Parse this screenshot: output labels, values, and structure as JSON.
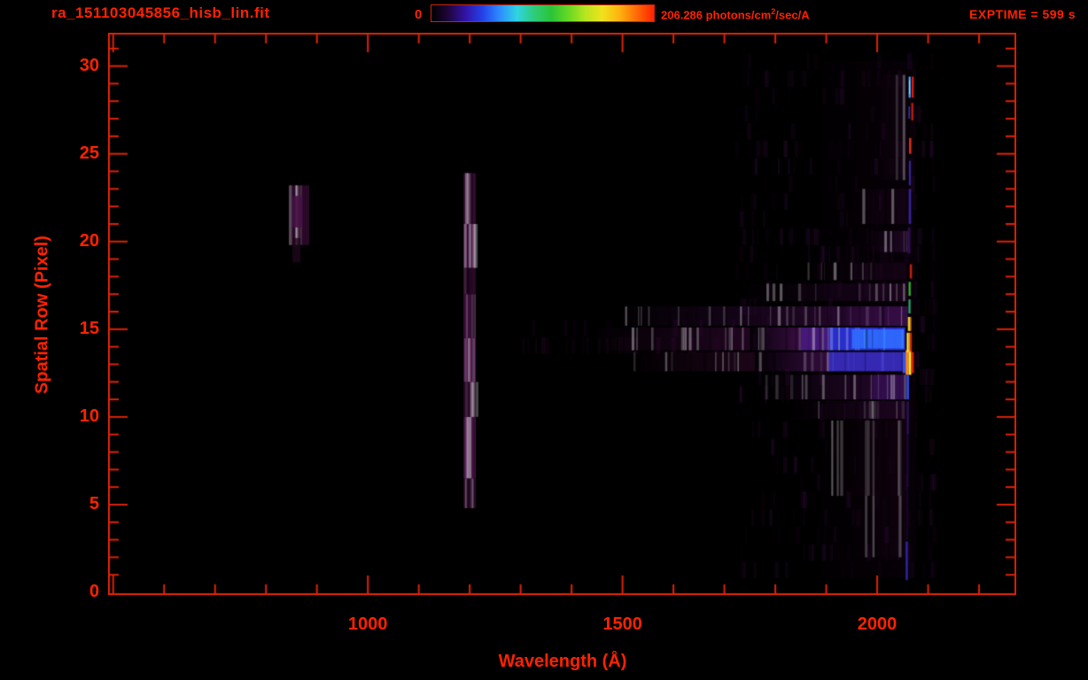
{
  "colors": {
    "accent": "#ff2200",
    "frame": "#dd2206",
    "background": "#000000"
  },
  "header": {
    "filename": "ra_151103045856_hisb_lin.fit",
    "exptime_label": "EXPTIME = 599 s",
    "colorbar": {
      "min_label": "0",
      "max_label_prefix": "206.286 photons/cm",
      "max_label_sup": "2",
      "max_label_suffix": "/sec/A",
      "gradient": [
        "#000000",
        "#20063c",
        "#3313a8",
        "#2542e8",
        "#2e8cff",
        "#2fd4e2",
        "#2ecc7a",
        "#2bc437",
        "#66d824",
        "#b8e51e",
        "#f0e21c",
        "#ffb10e",
        "#ff6a06",
        "#ff2200"
      ]
    }
  },
  "chart_data": {
    "type": "heatmap",
    "title": "ra_151103045856_hisb_lin.fit",
    "xlabel": "Wavelength (Å)",
    "ylabel": "Spatial Row (Pixel)",
    "x_range": [
      490,
      2273
    ],
    "y_range": [
      -0.15,
      31.9
    ],
    "x_major_ticks": [
      1000,
      1500,
      2000
    ],
    "x_major_unlabeled": [
      500
    ],
    "x_minor_step": 100,
    "y_major_ticks": [
      0,
      5,
      10,
      15,
      20,
      25,
      30
    ],
    "y_minor_step": 1,
    "colorbar": {
      "min": 0,
      "max": 206.286,
      "units": "photons/cm2/sec/A"
    },
    "exptime_seconds": 599,
    "grid": false,
    "legend": "none",
    "description": "Far-UV slit spectrogram: faint Lyman-alpha airglow band near 1200 A over rows 5-24, a faint emission blob near 870 A rows 20-23, a bright stellar continuum in rows 12-16 strengthening from ~1500 A to ~2060 A (peaking blue/cyan at rows 13.8-15), and a saturated multicolor emission spike at ~2063 A spanning rows 1-29.",
    "features": {
      "wash": [
        [
          1850,
          2075,
          0.8,
          30.3,
          "#0d020d",
          0.55,
          1,
          0
        ]
      ],
      "rects": [
        [
          1188,
          1212,
          4.8,
          6.5,
          "#2a0928",
          0.95,
          0,
          1
        ],
        [
          1188,
          1212,
          6.5,
          10.0,
          "#451243",
          0.95,
          0,
          1
        ],
        [
          1188,
          1212,
          10.0,
          12.0,
          "#2e0a2c",
          0.95,
          0,
          1
        ],
        [
          1188,
          1212,
          12.0,
          14.5,
          "#491347",
          0.95,
          0,
          1
        ],
        [
          1188,
          1212,
          14.5,
          17.0,
          "#3d0f3b",
          0.95,
          0,
          1
        ],
        [
          1188,
          1212,
          17.0,
          18.5,
          "#2a0928",
          0.95,
          0,
          1
        ],
        [
          1188,
          1212,
          18.5,
          21.0,
          "#451243",
          0.95,
          0,
          1
        ],
        [
          1188,
          1212,
          21.0,
          23.9,
          "#350c33",
          0.95,
          0,
          1
        ],
        [
          845,
          885,
          19.8,
          23.2,
          "#2d092b",
          0.9,
          0,
          1
        ],
        [
          852,
          872,
          20.8,
          22.6,
          "#451144",
          0.9,
          0,
          0
        ],
        [
          852,
          868,
          18.8,
          20.2,
          "#1e061c",
          0.8,
          0,
          0
        ],
        [
          1500,
          2060,
          15.2,
          16.3,
          "#2e0a36",
          0.9,
          1,
          1
        ],
        [
          1900,
          2060,
          15.2,
          16.3,
          "#3a1050",
          0.7,
          1,
          1
        ],
        [
          1450,
          1750,
          13.8,
          15.1,
          "#260726",
          0.85,
          1,
          1
        ],
        [
          1750,
          1850,
          13.8,
          15.1,
          "#3c0e46",
          0.95,
          1,
          1
        ],
        [
          1850,
          1905,
          13.8,
          15.1,
          "#4a1a80",
          0.95,
          0,
          1
        ],
        [
          1905,
          2055,
          13.8,
          15.1,
          "#2a30d8",
          0.95,
          0,
          1
        ],
        [
          1950,
          2052,
          13.9,
          15.0,
          "#2f6bff",
          0.9,
          0,
          1,
          "#54e2ff"
        ],
        [
          1520,
          1760,
          12.6,
          13.7,
          "#23071f",
          0.8,
          1,
          1
        ],
        [
          1760,
          1905,
          12.6,
          13.7,
          "#3a0d46",
          0.9,
          1,
          1
        ],
        [
          1905,
          2050,
          12.6,
          13.7,
          "#3b2cc4",
          0.9,
          0,
          1,
          "#5a6aff"
        ],
        [
          2050,
          2056,
          12.5,
          13.7,
          "#3a55ff",
          0.95,
          0,
          0
        ],
        [
          2056,
          2062,
          12.4,
          13.8,
          "#ff8c1c",
          1,
          0,
          0
        ],
        [
          2062,
          2067,
          12.4,
          13.8,
          "#ffe93a",
          1,
          0,
          0
        ],
        [
          2067,
          2072,
          12.5,
          13.7,
          "#e02211",
          0.95,
          0,
          0
        ],
        [
          1780,
          2055,
          11.0,
          12.4,
          "#2c0a34",
          0.85,
          1,
          1
        ],
        [
          1990,
          2055,
          11.0,
          12.4,
          "#3a1260",
          0.6,
          0,
          1
        ],
        [
          1840,
          2056,
          9.9,
          10.9,
          "#220726",
          0.8,
          1,
          1
        ],
        [
          1740,
          2058,
          16.6,
          17.6,
          "#200624",
          0.75,
          1,
          1
        ],
        [
          1860,
          2058,
          17.8,
          18.8,
          "#1a051a",
          0.65,
          1,
          1
        ],
        [
          1985,
          2058,
          19.4,
          20.6,
          "#2c0a33",
          0.7,
          1,
          1
        ],
        [
          1950,
          2058,
          21.0,
          23.0,
          "#1c051e",
          0.6,
          1,
          1
        ],
        [
          2000,
          2058,
          23.5,
          29.5,
          "#160517",
          0.6,
          1,
          1
        ],
        [
          1955,
          2056,
          2.0,
          9.8,
          "#150413",
          0.6,
          1,
          1
        ],
        [
          1905,
          2056,
          5.5,
          9.8,
          "#120310",
          0.5,
          1,
          1
        ]
      ],
      "line": {
        "tilt_A_per_row": 0.22,
        "ref_row": 14,
        "segments": [
          [
            28.2,
            29.4,
            2058.5,
            2062.5,
            "#49a6ff",
            1
          ],
          [
            28.4,
            29.2,
            2059.5,
            2061.2,
            "#a8ecff",
            0.9
          ],
          [
            28.2,
            29.4,
            2064.5,
            2068.5,
            "#e02211",
            0.95
          ],
          [
            26.9,
            27.9,
            2064.0,
            2068.0,
            "#d01c10",
            0.95
          ],
          [
            27.0,
            27.7,
            2058.5,
            2061.5,
            "#3346cc",
            0.8
          ],
          [
            25.0,
            25.9,
            2060.0,
            2064.5,
            "#e03314",
            0.95
          ],
          [
            23.2,
            24.6,
            2060.0,
            2064.0,
            "#3f2fae",
            0.8
          ],
          [
            21.0,
            23.0,
            2060.0,
            2065.0,
            "#4a2fd0",
            0.7
          ],
          [
            19.3,
            20.8,
            2059.0,
            2064.0,
            "#380e66",
            0.8
          ],
          [
            17.9,
            18.7,
            2063.0,
            2067.5,
            "#d02212",
            0.92
          ],
          [
            16.9,
            17.7,
            2061.0,
            2065.0,
            "#2fc32f",
            0.95
          ],
          [
            15.9,
            16.7,
            2061.0,
            2065.0,
            "#24bb77",
            0.9
          ],
          [
            14.9,
            15.7,
            2060.0,
            2064.5,
            "#ffd52a",
            0.95
          ],
          [
            14.9,
            15.7,
            2064.5,
            2066.5,
            "#ff9a1c",
            0.9
          ],
          [
            13.7,
            14.8,
            2058.0,
            2062.0,
            "#ffea3c",
            1
          ],
          [
            13.7,
            14.8,
            2062.0,
            2065.0,
            "#ff8c1c",
            1
          ],
          [
            13.7,
            14.8,
            2065.0,
            2068.0,
            "#e02211",
            0.95
          ],
          [
            11.0,
            12.4,
            2058.0,
            2063.0,
            "#2f49e8",
            0.95
          ],
          [
            9.0,
            10.9,
            2059.0,
            2063.0,
            "#3a1470",
            0.8
          ],
          [
            6.0,
            9.0,
            2059.0,
            2063.0,
            "#2a0a50",
            0.7
          ],
          [
            3.0,
            6.0,
            2059.0,
            2063.0,
            "#200640",
            0.6
          ],
          [
            0.7,
            2.9,
            2058.5,
            2063.0,
            "#3428b8",
            0.85
          ]
        ]
      },
      "noise_fields": [
        {
          "x": [
            1720,
            2110
          ],
          "r": [
            0.8,
            30.3
          ],
          "colors": [
            "#1d0620",
            "#2a0a33",
            "#140411",
            "#23082b"
          ],
          "count": 420,
          "seed": 13,
          "bias": 1.6
        },
        {
          "x": [
            1290,
            1720
          ],
          "r": [
            13.6,
            15.2
          ],
          "colors": [
            "#1a051a",
            "#240724"
          ],
          "count": 45,
          "seed": 7,
          "bias": 1.0
        }
      ]
    }
  }
}
